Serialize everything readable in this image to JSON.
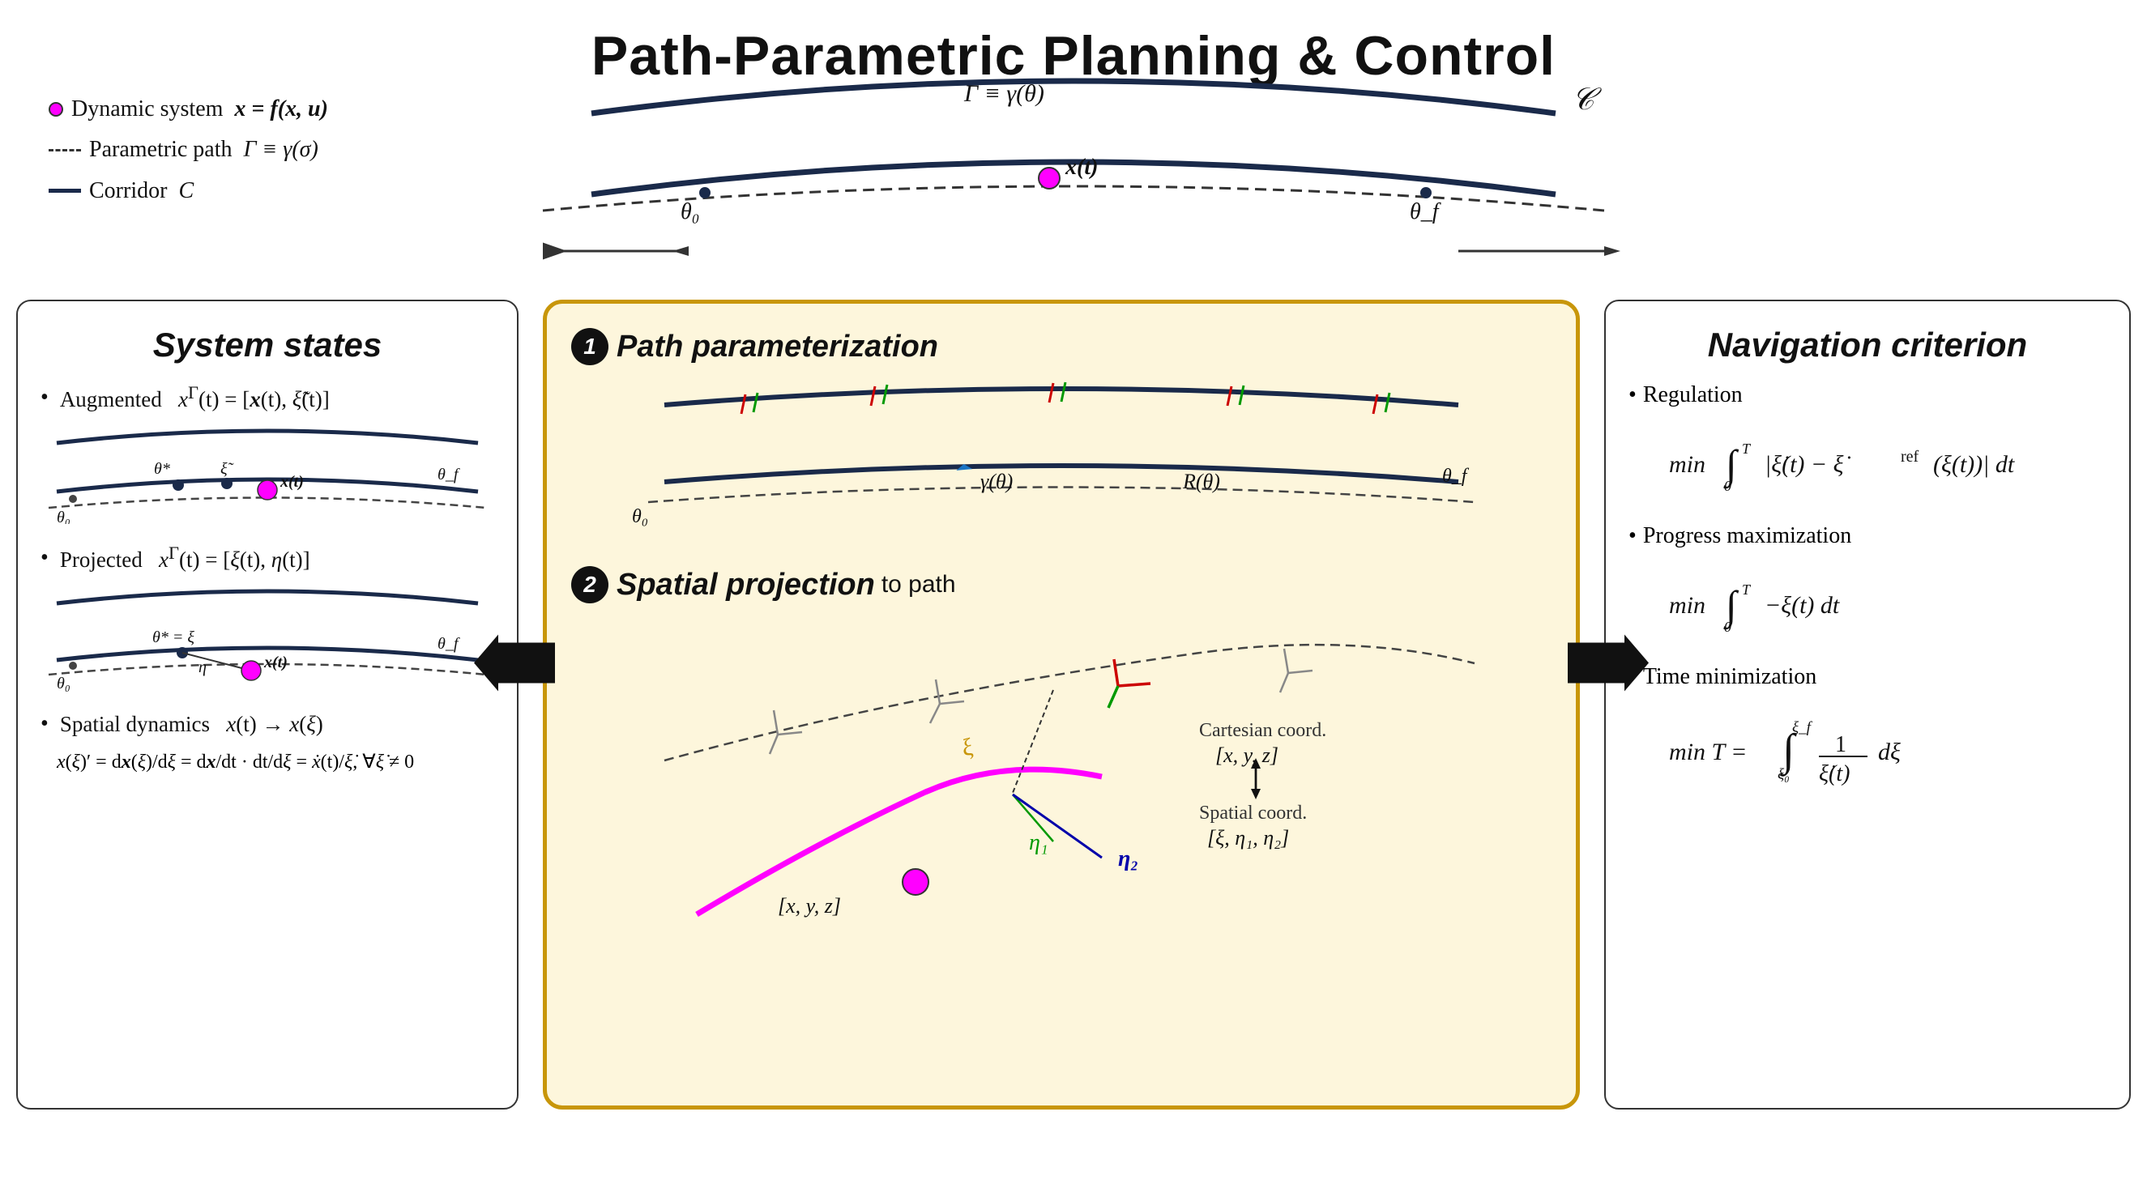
{
  "title": "Path-Parametric Planning & Control",
  "legend": {
    "dynamic_system": "Dynamic system",
    "dynamic_eq": "x = f(x, u)",
    "parametric_path": "Parametric path",
    "path_eq": "Γ ≡ γ(σ)",
    "corridor": "Corridor",
    "corridor_sym": "C"
  },
  "top_diagram": {
    "path_label": "Γ ≡ γ(θ)",
    "corridor_label": "C",
    "theta_0": "θ₀",
    "theta_f": "θ_f",
    "x_t": "x(t)"
  },
  "panel_left": {
    "title": "System states",
    "items": [
      {
        "label": "Augmented",
        "eq": "x^Γ(t) = [x(t), ξ̃(t)]",
        "theta_star": "θ* ξ̃",
        "theta_f": "θ_f",
        "theta_0": "θ₀",
        "x_t": "x(t)"
      },
      {
        "label": "Projected",
        "eq": "x^Γ(t) = [ξ(t), η(t)]",
        "theta_star": "θ* = ξ",
        "theta_f": "θ_f",
        "theta_0": "θ₀",
        "eta": "η",
        "x_t": "x(t)"
      },
      {
        "label": "Spatial dynamics",
        "eq": "x(t) → x(ξ)"
      }
    ],
    "dynamics_eq": "x(ξ)' = dx(ξ)/dξ = dx/dt · dt/dξ = ẋ(t)/ξ̇, ∀ξ̇ ≠ 0"
  },
  "panel_center": {
    "section1": {
      "number": "1",
      "title": "Path parameterization",
      "theta_0": "θ₀",
      "theta_f": "θ_f",
      "gamma": "γ(θ)",
      "R": "R(θ)"
    },
    "section2": {
      "number": "2",
      "title": "Spatial projection",
      "subtitle": "to path",
      "xi_label": "ξ",
      "eta1_label": "η₁",
      "eta2_label": "η₂",
      "cartesian": "Cartesian coord.",
      "cartesian_eq": "[x, y, z]",
      "spatial": "Spatial coord.",
      "spatial_eq": "[ξ, η₁, η₂]",
      "xyz_label": "[x, y, z]"
    }
  },
  "panel_right": {
    "title": "Navigation criterion",
    "items": [
      {
        "label": "Regulation",
        "formula": "min ∫₀ᵀ |ξ̇(t) − ξ̇_ref(ξ(t))| dt"
      },
      {
        "label": "Progress maximization",
        "formula": "min ∫₀ᵀ −ξ(t) dt"
      },
      {
        "label": "Time minimization",
        "formula": "min T = ∫_{ξ₀}^{ξ_f} 1/ξ̇(t) dξ"
      }
    ]
  },
  "arrows": {
    "left": "←",
    "right": "→"
  }
}
